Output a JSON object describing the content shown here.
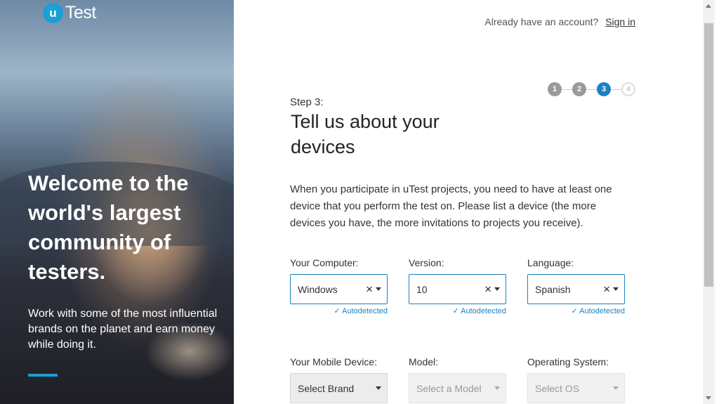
{
  "hero": {
    "logo_mark": "u",
    "logo_text": "Test",
    "title": "Welcome to the world's largest community of testers.",
    "subtitle": "Work with some of the most influential brands on the planet and earn money while doing it."
  },
  "header": {
    "account_prompt": "Already have an account?",
    "signin_label": "Sign in"
  },
  "stepper": {
    "steps": [
      "1",
      "2",
      "3",
      "4"
    ],
    "current": 3
  },
  "form": {
    "step_label": "Step 3:",
    "title": "Tell us about your devices",
    "intro": "When you participate in uTest projects, you need to have at least one device that you perform the test on. Please list a device (the more devices you have, the more invitations to projects you receive).",
    "computer": {
      "computer_label": "Your Computer:",
      "computer_value": "Windows",
      "version_label": "Version:",
      "version_value": "10",
      "language_label": "Language:",
      "language_value": "Spanish",
      "autodetected": "Autodetected"
    },
    "mobile": {
      "device_label": "Your Mobile Device:",
      "device_placeholder": "Select Brand",
      "model_label": "Model:",
      "model_placeholder": "Select a Model",
      "os_label": "Operating System:",
      "os_placeholder": "Select OS"
    }
  },
  "colors": {
    "accent": "#1a82c4",
    "brand": "#1a9fd6"
  }
}
